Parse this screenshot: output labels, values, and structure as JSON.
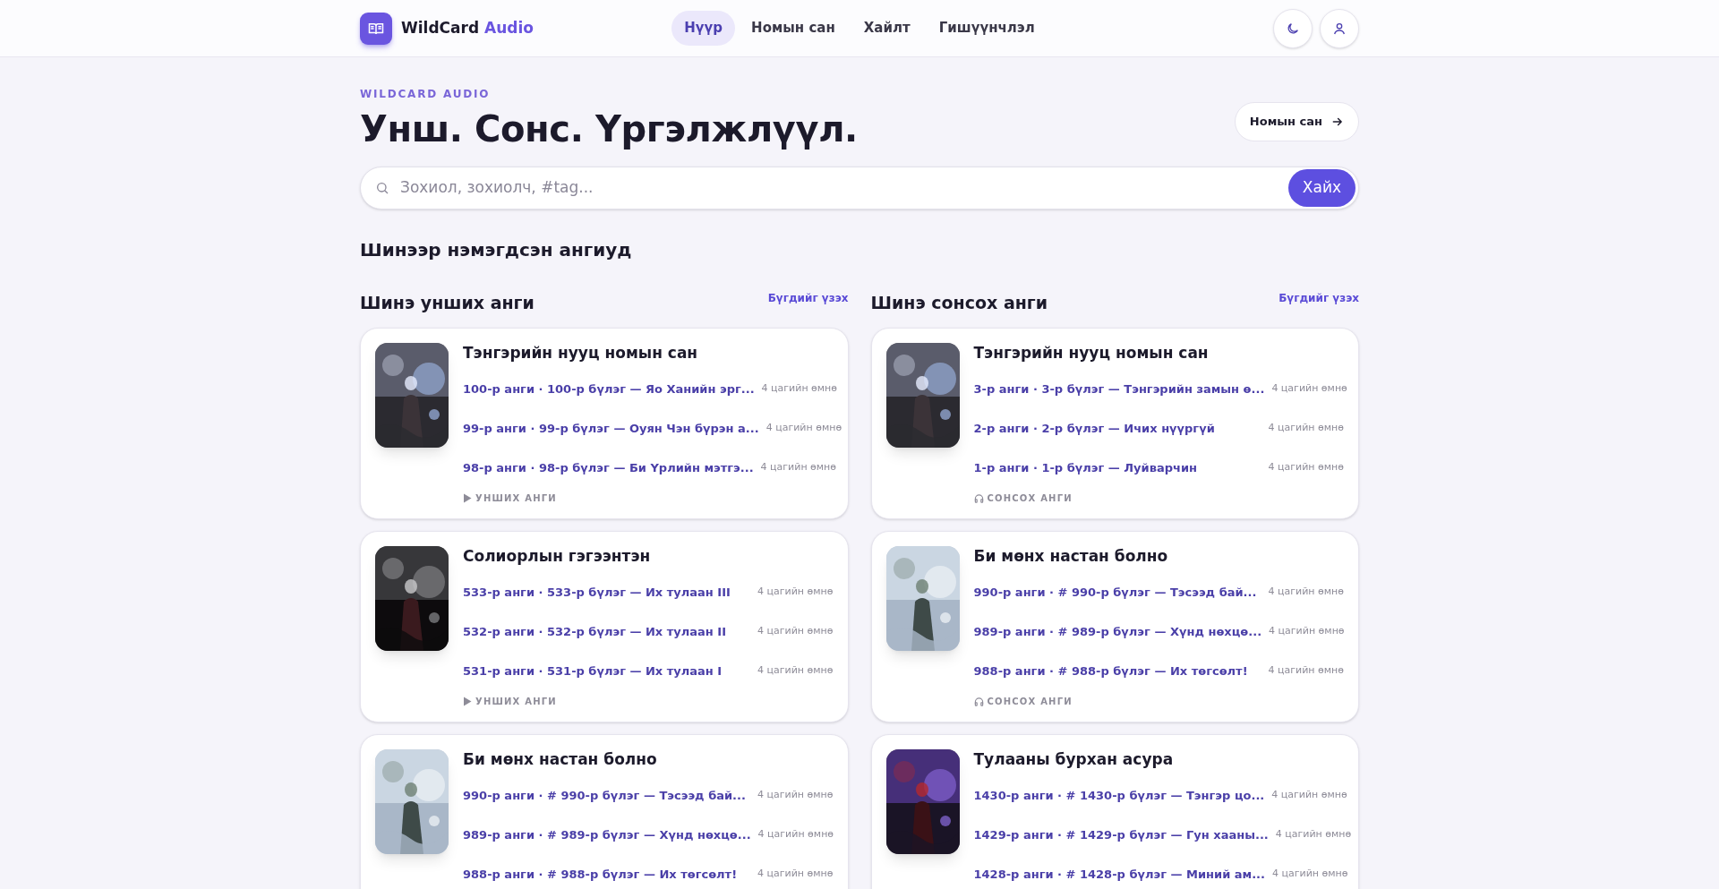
{
  "header": {
    "brand": "WildCard",
    "brand_accent": "Audio",
    "nav": [
      {
        "label": "Нүүр",
        "selected": true
      },
      {
        "label": "Номын сан",
        "selected": false
      },
      {
        "label": "Хайлт",
        "selected": false
      },
      {
        "label": "Гишүүнчлэл",
        "selected": false
      }
    ]
  },
  "hero": {
    "eyebrow": "WILDCARD AUDIO",
    "title": "Унш. Сонс. Үргэлжлүүл.",
    "library_button": "Номын сан"
  },
  "search": {
    "placeholder": "Зохиол, зохиолч, #tag...",
    "button": "Хайх"
  },
  "section_title": "Шинээр нэмэгдсэн ангиуд",
  "columns": [
    {
      "title": "Шинэ унших анги",
      "see_all": "Бүгдийг үзэх",
      "cards": [
        {
          "title": "Тэнгэрийн нууц номын сан",
          "cover": {
            "kind": "picture"
          },
          "episodes": [
            {
              "label": "100-р анги · 100-р бүлэг — Яо Ханийн эрг...",
              "time": "4 цагийн өмнө"
            },
            {
              "label": "99-р анги · 99-р бүлэг — Оуян Чэн бүрэн а...",
              "time": "4 цагийн өмнө"
            },
            {
              "label": "98-р анги · 98-р бүлэг — Би Үрлийн мэтгэ...",
              "time": "4 цагийн өмнө"
            }
          ],
          "footer": {
            "kind": "read",
            "label": "УНШИХ АНГИ"
          }
        },
        {
          "title": "Солиорлын гэгээнтэн",
          "cover": {
            "kind": "picture"
          },
          "episodes": [
            {
              "label": "533-р анги · 533-р бүлэг — Их тулаан III",
              "time": "4 цагийн өмнө"
            },
            {
              "label": "532-р анги · 532-р бүлэг — Их тулаан II",
              "time": "4 цагийн өмнө"
            },
            {
              "label": "531-р анги · 531-р бүлэг — Их тулаан I",
              "time": "4 цагийн өмнө"
            }
          ],
          "footer": {
            "kind": "read",
            "label": "УНШИХ АНГИ"
          }
        },
        {
          "title": "Би мөнх настан болно",
          "cover": {
            "kind": "picture"
          },
          "episodes": [
            {
              "label": "990-р анги · # 990-р бүлэг — Тэсээд бай...",
              "time": "4 цагийн өмнө"
            },
            {
              "label": "989-р анги · # 989-р бүлэг — Хүнд нөхцө...",
              "time": "4 цагийн өмнө"
            },
            {
              "label": "988-р анги · # 988-р бүлэг — Их төгсөлт!",
              "time": "4 цагийн өмнө"
            }
          ]
        }
      ]
    },
    {
      "title": "Шинэ сонсох анги",
      "see_all": "Бүгдийг үзэх",
      "cards": [
        {
          "title": "Тэнгэрийн нууц номын сан",
          "cover": {
            "kind": "picture"
          },
          "episodes": [
            {
              "label": "3-р анги · 3-р бүлэг — Тэнгэрийн замын ө...",
              "time": "4 цагийн өмнө"
            },
            {
              "label": "2-р анги · 2-р бүлэг — Ичих нүүргүй",
              "time": "4 цагийн өмнө"
            },
            {
              "label": "1-р анги · 1-р бүлэг — Луйварчин",
              "time": "4 цагийн өмнө"
            }
          ],
          "footer": {
            "kind": "listen",
            "label": "СОНСОХ АНГИ"
          }
        },
        {
          "title": "Би мөнх настан болно",
          "cover": {
            "kind": "picture"
          },
          "episodes": [
            {
              "label": "990-р анги · # 990-р бүлэг — Тэсээд бай...",
              "time": "4 цагийн өмнө"
            },
            {
              "label": "989-р анги · # 989-р бүлэг — Хүнд нөхцө...",
              "time": "4 цагийн өмнө"
            },
            {
              "label": "988-р анги · # 988-р бүлэг — Их төгсөлт!",
              "time": "4 цагийн өмнө"
            }
          ],
          "footer": {
            "kind": "listen",
            "label": "СОНСОХ АНГИ"
          }
        },
        {
          "title": "Тулааны бурхан асура",
          "cover": {
            "kind": "picture"
          },
          "episodes": [
            {
              "label": "1430-р анги · # 1430-р бүлэг — Тэнгэр цо...",
              "time": "4 цагийн өмнө"
            },
            {
              "label": "1429-р анги · # 1429-р бүлэг — Гун хааны...",
              "time": "4 цагийн өмнө"
            },
            {
              "label": "1428-р анги · # 1428-р бүлэг — Миний ам...",
              "time": "4 цагийн өмнө"
            }
          ]
        }
      ]
    }
  ]
}
